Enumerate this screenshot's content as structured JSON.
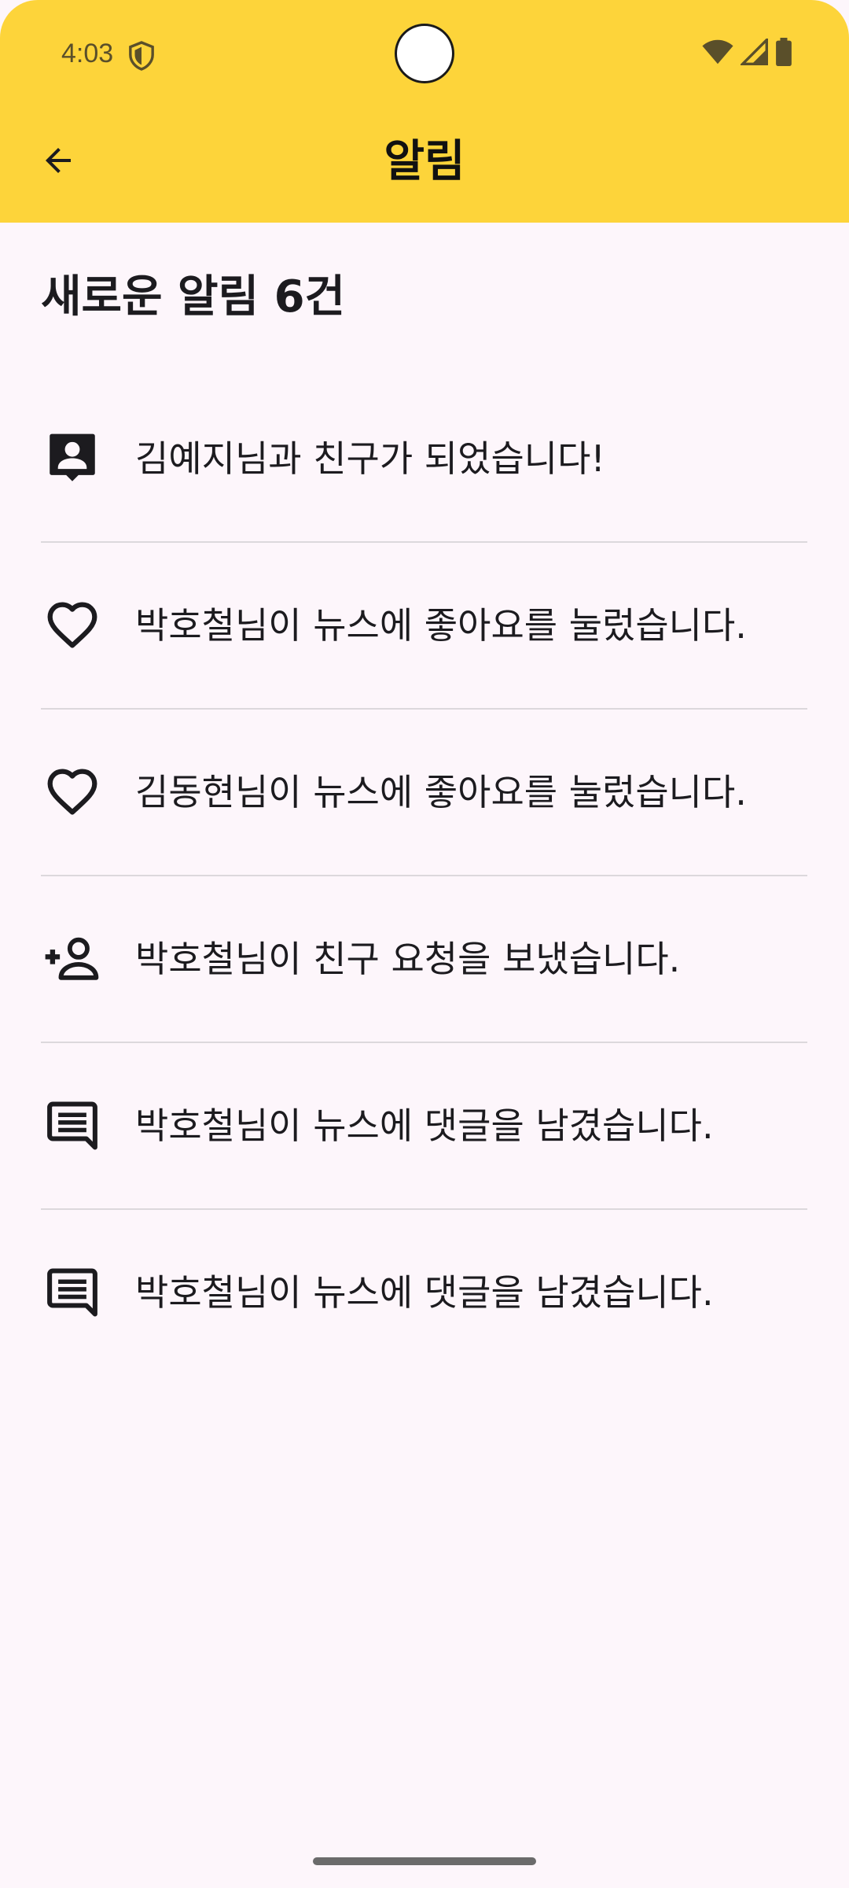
{
  "status_bar": {
    "time": "4:03",
    "icons": [
      "shield-icon",
      "wifi-icon",
      "signal-icon",
      "battery-icon"
    ]
  },
  "app_bar": {
    "title": "알림",
    "back_icon": "arrow-back-icon",
    "background_color": "#fdd43a"
  },
  "section": {
    "title": "새로운 알림 6건"
  },
  "notifications": [
    {
      "icon": "contact-icon",
      "text": "김예지님과 친구가 되었습니다!"
    },
    {
      "icon": "heart-icon",
      "text": "박호철님이 뉴스에 좋아요를 눌렀습니다."
    },
    {
      "icon": "heart-icon",
      "text": "김동현님이 뉴스에 좋아요를 눌렀습니다."
    },
    {
      "icon": "person-add-icon",
      "text": "박호철님이 친구 요청을 보냈습니다."
    },
    {
      "icon": "comment-icon",
      "text": "박호철님이 뉴스에 댓글을 남겼습니다."
    },
    {
      "icon": "comment-icon",
      "text": "박호철님이 뉴스에 댓글을 남겼습니다."
    }
  ]
}
